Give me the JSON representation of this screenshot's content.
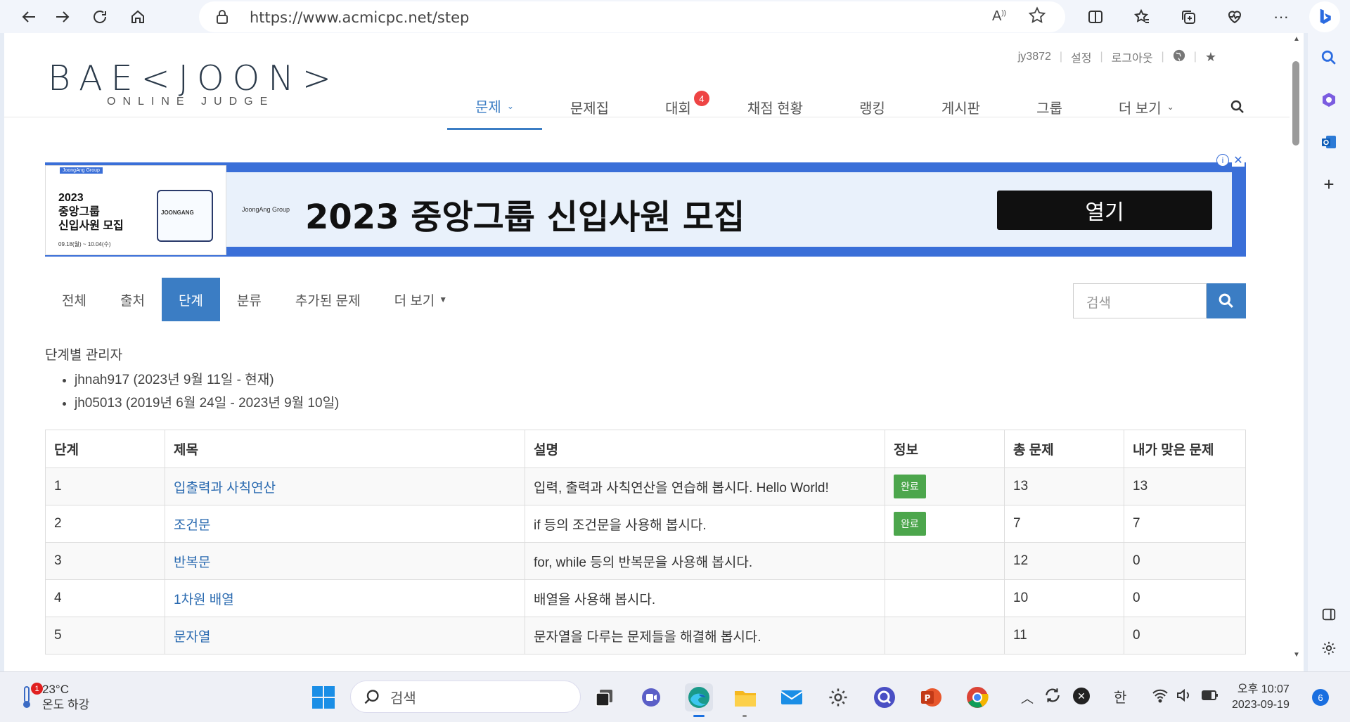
{
  "browser": {
    "url": "https://www.acmicpc.net/step"
  },
  "site": {
    "logo_main": "BAE<JOON>",
    "logo_sub": "ONLINE JUDGE",
    "user_links": [
      "jy3872",
      "설정",
      "로그아웃"
    ],
    "nav": [
      {
        "label": "문제",
        "dropdown": true,
        "active": true
      },
      {
        "label": "문제집"
      },
      {
        "label": "대회",
        "badge": "4"
      },
      {
        "label": "채점 현황"
      },
      {
        "label": "랭킹"
      },
      {
        "label": "게시판"
      },
      {
        "label": "그룹"
      },
      {
        "label": "더 보기",
        "dropdown": true
      }
    ]
  },
  "ad": {
    "image_tag": "JoongAng Group",
    "image_title": "2023\n중앙그룹\n신입사원 모집",
    "image_dates": "09.18(월) ~ 10.04(수)",
    "image_card": "JOONGANG",
    "brand": "JoongAng Group",
    "headline": "2023 중앙그룹 신입사원 모집",
    "open_label": "열기"
  },
  "subnav": {
    "items": [
      "전체",
      "출처",
      "단계",
      "분류",
      "추가된 문제",
      "더 보기"
    ],
    "active_index": 2,
    "search_placeholder": "검색"
  },
  "managers": {
    "heading": "단계별 관리자",
    "list": [
      "jhnah917 (2023년 9월 11일 - 현재)",
      "jh05013 (2019년 6월 24일 - 2023년 9월 10일)"
    ]
  },
  "table": {
    "headers": [
      "단계",
      "제목",
      "설명",
      "정보",
      "총 문제",
      "내가 맞은 문제"
    ],
    "rows": [
      {
        "step": "1",
        "title": "입출력과 사칙연산",
        "desc": "입력, 출력과 사칙연산을 연습해 봅시다. Hello World!",
        "info": "완료",
        "total": "13",
        "solved": "13"
      },
      {
        "step": "2",
        "title": "조건문",
        "desc": "if 등의 조건문을 사용해 봅시다.",
        "info": "완료",
        "total": "7",
        "solved": "7"
      },
      {
        "step": "3",
        "title": "반복문",
        "desc": "for, while 등의 반복문을 사용해 봅시다.",
        "info": "",
        "total": "12",
        "solved": "0"
      },
      {
        "step": "4",
        "title": "1차원 배열",
        "desc": "배열을 사용해 봅시다.",
        "info": "",
        "total": "10",
        "solved": "0"
      },
      {
        "step": "5",
        "title": "문자열",
        "desc": "문자열을 다루는 문제들을 해결해 봅시다.",
        "info": "",
        "total": "11",
        "solved": "0"
      }
    ]
  },
  "taskbar": {
    "weather_temp": "23°C",
    "weather_desc": "온도 하강",
    "weather_alert": "1",
    "search_label": "검색",
    "ime": "한",
    "time_period": "오후 10:07",
    "date": "2023-09-19",
    "notification_count": "6"
  }
}
